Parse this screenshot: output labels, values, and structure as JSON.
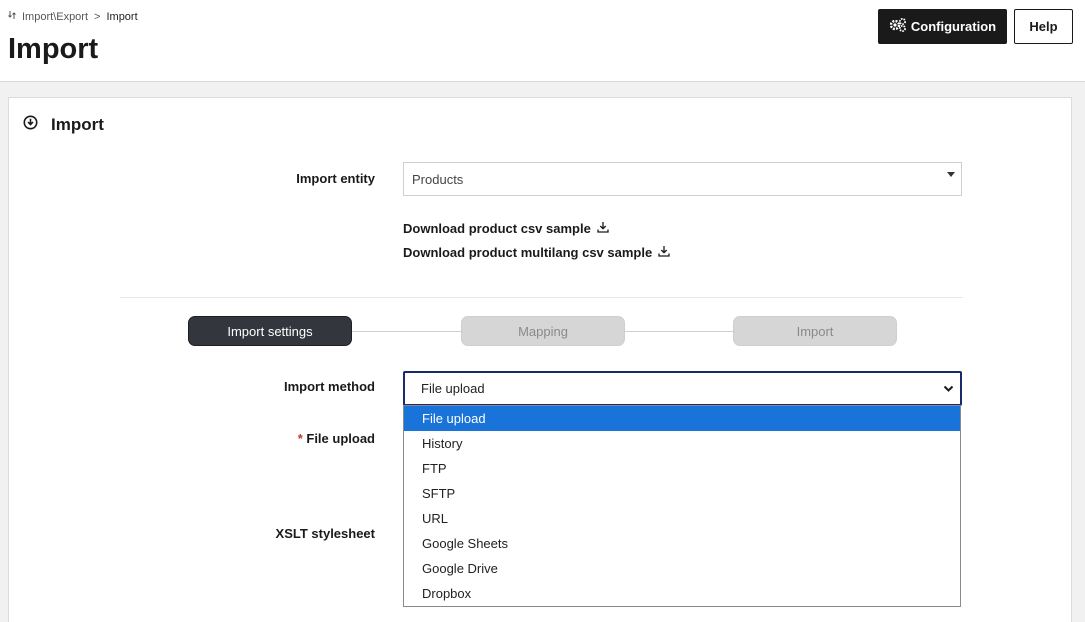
{
  "breadcrumb": {
    "parent": "Import\\Export",
    "separator": ">",
    "current": "Import"
  },
  "page_title": "Import",
  "header_buttons": {
    "configuration": "Configuration",
    "help": "Help"
  },
  "panel": {
    "title": "Import"
  },
  "import_entity": {
    "label": "Import entity",
    "value": "Products"
  },
  "downloads": [
    {
      "label": "Download product csv sample"
    },
    {
      "label": "Download product multilang csv sample"
    }
  ],
  "steps": [
    {
      "label": "Import settings",
      "state": "active"
    },
    {
      "label": "Mapping",
      "state": "inactive"
    },
    {
      "label": "Import",
      "state": "inactive"
    }
  ],
  "import_method": {
    "label": "Import method",
    "value": "File upload",
    "options": [
      "File upload",
      "History",
      "FTP",
      "SFTP",
      "URL",
      "Google Sheets",
      "Google Drive",
      "Dropbox"
    ],
    "selected_index": 0
  },
  "file_upload": {
    "required_marker": "*",
    "label": "File upload"
  },
  "xslt": {
    "label": "XSLT stylesheet"
  },
  "colors": {
    "primary_dark": "#1a1a1a",
    "selected_option": "#1a73d9",
    "focus_border": "#1a2a6c",
    "required": "#c0392b"
  }
}
